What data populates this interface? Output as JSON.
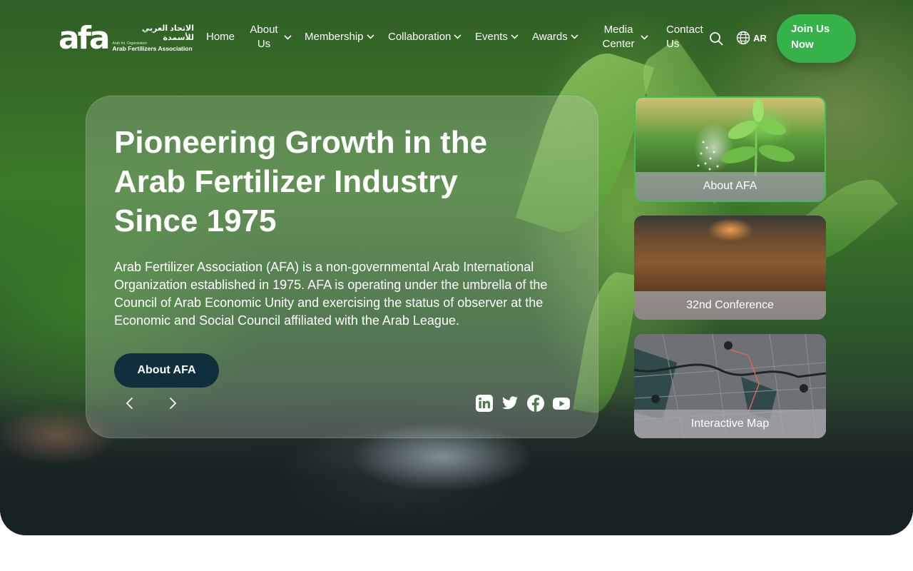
{
  "nav": {
    "logo": {
      "mark": "afa",
      "arabic": "الاتحاد العربي للأسمدة",
      "sub": "Arab Int. Organization",
      "english": "Arab Fertilizers Association"
    },
    "items": [
      {
        "label": "Home"
      },
      {
        "label_line1": "About",
        "label_line2": "Us"
      },
      {
        "label": "Membership"
      },
      {
        "label": "Collaboration"
      },
      {
        "label": "Events"
      },
      {
        "label": "Awards"
      },
      {
        "label_line1": "Media",
        "label_line2": "Center"
      },
      {
        "label_line1": "Contact",
        "label_line2": "Us"
      }
    ],
    "language": "AR",
    "join_line1": "Join Us",
    "join_line2": "Now"
  },
  "hero": {
    "headline_line1": "Pioneering Growth in the",
    "headline_line2": "Arab Fertilizer Industry",
    "headline_line3": "Since 1975",
    "description": "Arab Fertilizer Association (AFA) is a non-governmental Arab International Organization established in 1975. AFA is operating under the umbrella of the Council of Arab Economic Unity and exercising the status of observer at the Economic and Social Council affiliated with the Arab League.",
    "cta_label": "About AFA"
  },
  "social": [
    "linkedin-icon",
    "twitter-icon",
    "facebook-icon",
    "youtube-icon"
  ],
  "side_cards": [
    {
      "label": "About AFA"
    },
    {
      "label": "32nd Conference"
    },
    {
      "label": "Interactive Map"
    }
  ],
  "colors": {
    "accent_green": "#36b24a",
    "cta_dark": "#0e2f3c"
  }
}
